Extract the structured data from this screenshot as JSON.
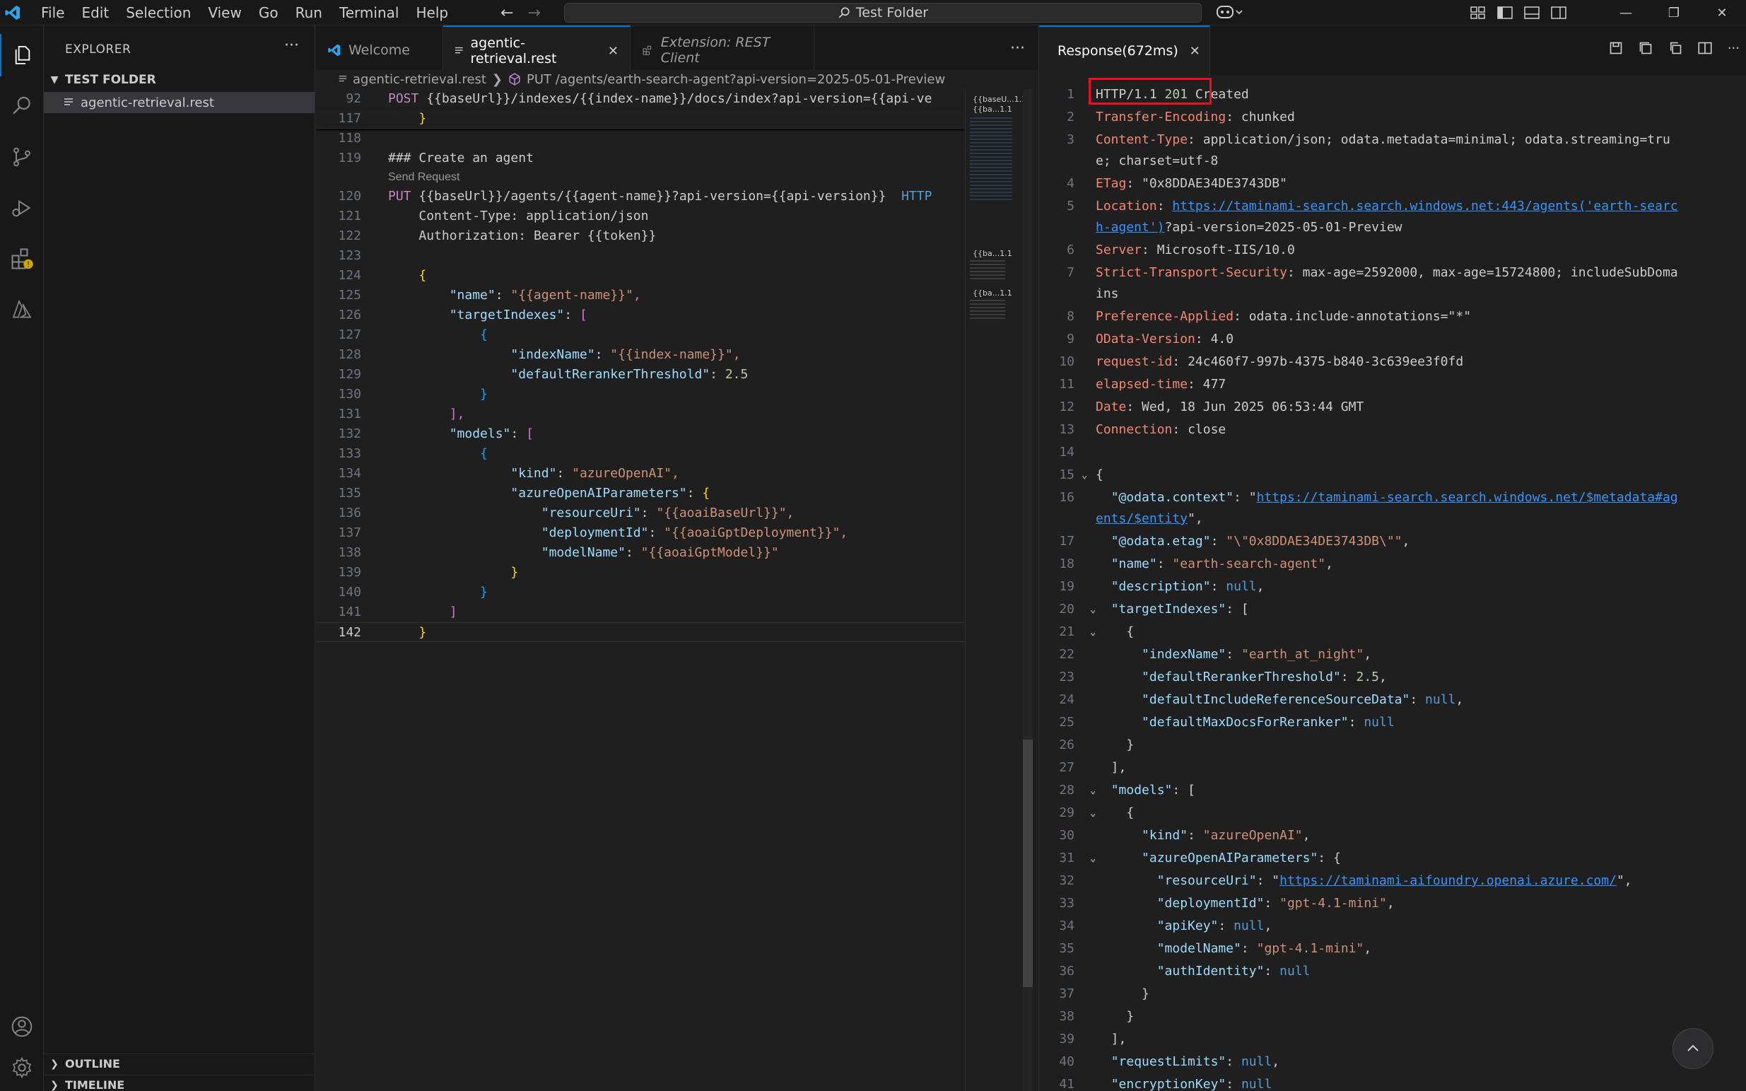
{
  "window": {
    "title": "Test Folder"
  },
  "menu": [
    "File",
    "Edit",
    "Selection",
    "View",
    "Go",
    "Run",
    "Terminal",
    "Help"
  ],
  "sidebar": {
    "title": "EXPLORER",
    "more": "···",
    "folder": "TEST FOLDER",
    "file": "agentic-retrieval.rest",
    "outline": "OUTLINE",
    "timeline": "TIMELINE"
  },
  "editor": {
    "tabs": [
      {
        "label": "Welcome"
      },
      {
        "label": "agentic-retrieval.rest"
      },
      {
        "label": "Extension: REST Client"
      }
    ],
    "breadcrumb": {
      "file": "agentic-retrieval.rest",
      "symbol": "PUT /agents/earth-search-agent?api-version=2025-05-01-Preview"
    },
    "send_request": "Send Request",
    "line_numbers": [
      "92",
      "117",
      "118",
      "119",
      "120",
      "121",
      "122",
      "123",
      "124",
      "125",
      "126",
      "127",
      "128",
      "129",
      "130",
      "131",
      "132",
      "133",
      "134",
      "135",
      "136",
      "137",
      "138",
      "139",
      "140",
      "141",
      "142"
    ],
    "minimap_labels": [
      "{{baseU...1.1",
      "{{ba...1.1",
      "{{ba...1.1",
      "{{ba...1.1"
    ],
    "code": {
      "l92": {
        "method": "POST",
        "url": "{{baseUrl}}/indexes/{{index-name}}/docs/index?api-version={{api-ve"
      },
      "l117": "}",
      "l119": "### Create an agent",
      "l120": {
        "method": "PUT",
        "url": "{{baseUrl}}/agents/{{agent-name}}?api-version={{api-version}}",
        "proto": "HTTP"
      },
      "l121": {
        "key": "Content-Type",
        "val": "application/json"
      },
      "l122": {
        "key": "Authorization",
        "val": "Bearer {{token}}"
      },
      "l124": "{",
      "l125": {
        "key": "\"name\"",
        "val": "\"{{agent-name}}\","
      },
      "l126": {
        "key": "\"targetIndexes\"",
        "val": "["
      },
      "l127": "{",
      "l128": {
        "key": "\"indexName\"",
        "val": "\"{{index-name}}\","
      },
      "l129": {
        "key": "\"defaultRerankerThreshold\"",
        "val": "2.5"
      },
      "l130": "}",
      "l131": "],",
      "l132": {
        "key": "\"models\"",
        "val": "["
      },
      "l133": "{",
      "l134": {
        "key": "\"kind\"",
        "val": "\"azureOpenAI\","
      },
      "l135": {
        "key": "\"azureOpenAIParameters\"",
        "val": "{"
      },
      "l136": {
        "key": "\"resourceUri\"",
        "val": "\"{{aoaiBaseUrl}}\","
      },
      "l137": {
        "key": "\"deploymentId\"",
        "val": "\"{{aoaiGptDeployment}}\","
      },
      "l138": {
        "key": "\"modelName\"",
        "val": "\"{{aoaiGptModel}}\""
      },
      "l139": "}",
      "l140": "}",
      "l141": "]",
      "l142": "}"
    }
  },
  "response": {
    "tab_label": "Response(672ms)",
    "line_numbers": [
      "1",
      "2",
      "3",
      "4",
      "5",
      "6",
      "7",
      "8",
      "9",
      "10",
      "11",
      "12",
      "13",
      "14",
      "15",
      "16",
      "17",
      "18",
      "19",
      "20",
      "21",
      "22",
      "23",
      "24",
      "25",
      "26",
      "27",
      "28",
      "29",
      "30",
      "31",
      "32",
      "33",
      "34",
      "35",
      "36",
      "37",
      "38",
      "39",
      "40",
      "41"
    ],
    "status": {
      "proto": "HTTP/1.1",
      "code": "201",
      "text": "Created"
    },
    "headers": [
      {
        "name": "Transfer-Encoding",
        "value": "chunked"
      },
      {
        "name": "Content-Type",
        "value": "application/json; odata.metadata=minimal; odata.streaming=tru",
        "wrap": "e; charset=utf-8"
      },
      {
        "name": "ETag",
        "value": "\"0x8DDAE34DE3743DB\""
      },
      {
        "name": "Location",
        "value": "https://taminami-search.search.windows.net:443/agents('earth-searc",
        "wrap_link": "h-agent')",
        "wrap_rest": "?api-version=2025-05-01-Preview"
      },
      {
        "name": "Server",
        "value": "Microsoft-IIS/10.0"
      },
      {
        "name": "Strict-Transport-Security",
        "value": "max-age=2592000, max-age=15724800; includeSubDoma",
        "wrap": "ins"
      },
      {
        "name": "Preference-Applied",
        "value": "odata.include-annotations=\"*\""
      },
      {
        "name": "OData-Version",
        "value": "4.0"
      },
      {
        "name": "request-id",
        "value": "24c460f7-997b-4375-b840-3c639ee3f0fd"
      },
      {
        "name": "elapsed-time",
        "value": "477"
      },
      {
        "name": "Date",
        "value": "Wed, 18 Jun 2025 06:53:44 GMT"
      },
      {
        "name": "Connection",
        "value": "close"
      }
    ],
    "body": {
      "odata_context_key": "\"@odata.context\"",
      "odata_context_val": "https://taminami-search.search.windows.net/$metadata#ag",
      "odata_context_wrap": "ents/$entity",
      "odata_etag_key": "\"@odata.etag\"",
      "odata_etag_val": "\"\\\"0x8DDAE34DE3743DB\\\"\"",
      "name_key": "\"name\"",
      "name_val": "\"earth-search-agent\"",
      "description_key": "\"description\"",
      "target_key": "\"targetIndexes\"",
      "index_name_key": "\"indexName\"",
      "index_name_val": "\"earth_at_night\"",
      "threshold_key": "\"defaultRerankerThreshold\"",
      "threshold_val": "2.5",
      "include_ref_key": "\"defaultIncludeReferenceSourceData\"",
      "max_docs_key": "\"defaultMaxDocsForReranker\"",
      "models_key": "\"models\"",
      "kind_key": "\"kind\"",
      "kind_val": "\"azureOpenAI\"",
      "params_key": "\"azureOpenAIParameters\"",
      "resource_key": "\"resourceUri\"",
      "resource_val": "https://taminami-aifoundry.openai.azure.com/",
      "deployment_key": "\"deploymentId\"",
      "deployment_val": "\"gpt-4.1-mini\"",
      "apikey_key": "\"apiKey\"",
      "model_name_key": "\"modelName\"",
      "model_name_val": "\"gpt-4.1-mini\"",
      "auth_key": "\"authIdentity\"",
      "limits_key": "\"requestLimits\"",
      "encryption_key": "\"encryptionKey\"",
      "null": "null"
    }
  }
}
